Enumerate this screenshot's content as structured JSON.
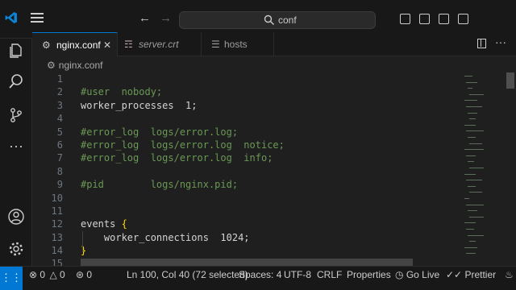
{
  "search": {
    "query": "conf"
  },
  "tabs": [
    {
      "label": "nginx.conf",
      "active": true,
      "icon": "gear-icon",
      "close": "✕"
    },
    {
      "label": "server.crt",
      "active": false,
      "icon": "certificate-icon"
    },
    {
      "label": "hosts",
      "active": false,
      "icon": "file-icon"
    }
  ],
  "breadcrumb": {
    "file": "nginx.conf"
  },
  "editor": {
    "lines": [
      {
        "n": "1",
        "text": "",
        "kind": "plain"
      },
      {
        "n": "2",
        "text": "#user  nobody;",
        "kind": "comment"
      },
      {
        "n": "3",
        "text": "worker_processes  1;",
        "kind": "plain"
      },
      {
        "n": "4",
        "text": "",
        "kind": "plain"
      },
      {
        "n": "5",
        "text": "#error_log  logs/error.log;",
        "kind": "comment"
      },
      {
        "n": "6",
        "text": "#error_log  logs/error.log  notice;",
        "kind": "comment"
      },
      {
        "n": "7",
        "text": "#error_log  logs/error.log  info;",
        "kind": "comment"
      },
      {
        "n": "8",
        "text": "",
        "kind": "plain"
      },
      {
        "n": "9",
        "text": "#pid        logs/nginx.pid;",
        "kind": "comment"
      },
      {
        "n": "10",
        "text": "",
        "kind": "plain"
      },
      {
        "n": "11",
        "text": "",
        "kind": "plain"
      },
      {
        "n": "12",
        "text": "events ",
        "brace": "{",
        "kind": "plain"
      },
      {
        "n": "13",
        "text": "    worker_connections  1024;",
        "kind": "plain"
      },
      {
        "n": "14",
        "text": "",
        "brace": "}",
        "kind": "plain"
      },
      {
        "n": "15",
        "text": "",
        "kind": "plain"
      }
    ]
  },
  "statusbar": {
    "remote_icon": "remote-icon",
    "errors": "0",
    "warnings": "0",
    "ports": "0",
    "position": "Ln 100, Col 40 (72 selected)",
    "spaces": "Spaces: 4",
    "encoding": "UTF-8",
    "eol": "CRLF",
    "language": "Properties",
    "golive": "Go Live",
    "prettier": "Prettier"
  },
  "colors": {
    "accent": "#0078d4",
    "comment": "#6a9955",
    "brace": "#ffd700"
  }
}
